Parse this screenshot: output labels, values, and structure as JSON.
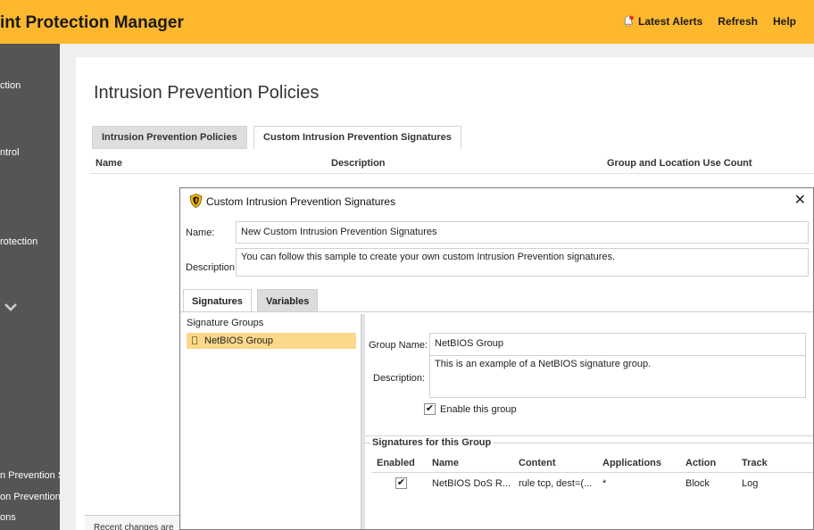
{
  "app": {
    "title": "int Protection Manager"
  },
  "header": {
    "latest_alerts": "Latest Alerts",
    "refresh": "Refresh",
    "help": "Help"
  },
  "sidebar": {
    "items": [
      {
        "label": "ction"
      },
      {
        "label": "ntrol"
      },
      {
        "label": "rotection"
      },
      {
        "label": "n Prevention S"
      },
      {
        "label": "on Prevention"
      },
      {
        "label": "ons"
      }
    ]
  },
  "page": {
    "title": "Intrusion Prevention Policies",
    "tabs": [
      "Intrusion Prevention Policies",
      "Custom Intrusion Prevention Signatures"
    ],
    "columns": [
      "Name",
      "Description",
      "Group and Location Use Count"
    ],
    "footer": "Recent changes are"
  },
  "dialog": {
    "title": "Custom Intrusion Prevention Signatures",
    "name_label": "Name:",
    "name_value": "New Custom Intrusion Prevention Signatures",
    "description_label": "Description:",
    "description_value": "You can follow this sample to create your own custom Intrusion Prevention signatures.",
    "tabs": [
      "Signatures",
      "Variables"
    ],
    "signature_groups_label": "Signature Groups",
    "groups": [
      {
        "name": "NetBIOS Group"
      }
    ],
    "group_name_label": "Group Name:",
    "group_name_value": "NetBIOS Group",
    "group_description_label": "Description:",
    "group_description_value": "This is an example of a NetBIOS signature group.",
    "enable_label": "Enable this group",
    "enabled": true,
    "signatures_section": "Signatures for this Group",
    "sig_columns": [
      "Enabled",
      "Name",
      "Content",
      "Applications",
      "Action",
      "Track"
    ],
    "signatures": [
      {
        "enabled": true,
        "name": "NetBIOS DoS R...",
        "content": "rule tcp, dest=(...",
        "applications": "*",
        "action": "Block",
        "track": "Log"
      }
    ]
  },
  "colors": {
    "header_bg": "#fdb82e",
    "sidebar_bg": "#555555",
    "selected_item": "#fbd88a"
  }
}
